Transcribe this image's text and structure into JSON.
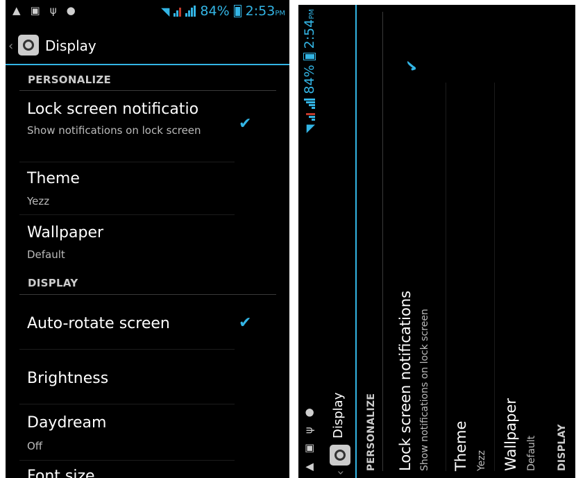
{
  "left": {
    "status": {
      "battery": "84%",
      "time": "2:53",
      "ampm": "PM"
    },
    "title": "Display",
    "personalize_header": "PERSONALIZE",
    "lock_title": "Lock screen notificatio",
    "lock_sub": "Show notifications on lock screen",
    "theme_title": "Theme",
    "theme_value": "Yezz",
    "wallpaper_title": "Wallpaper",
    "wallpaper_value": "Default",
    "display_header": "DISPLAY",
    "autorotate_title": "Auto-rotate screen",
    "brightness_title": "Brightness",
    "daydream_title": "Daydream",
    "daydream_value": "Off",
    "fontsize_title": "Font size",
    "lock_checked": true,
    "autorotate_checked": true
  },
  "right": {
    "status": {
      "battery": "84%",
      "time": "2:54",
      "ampm": "PM"
    },
    "title": "Display",
    "personalize_header": "PERSONALIZE",
    "lock_title": "Lock screen notifications",
    "lock_sub": "Show notifications on lock screen",
    "theme_title": "Theme",
    "theme_value": "Yezz",
    "wallpaper_title": "Wallpaper",
    "wallpaper_value": "Default",
    "display_header": "DISPLAY",
    "lock_checked": true
  },
  "colors": {
    "accent": "#33b5e5",
    "background": "#000000"
  }
}
